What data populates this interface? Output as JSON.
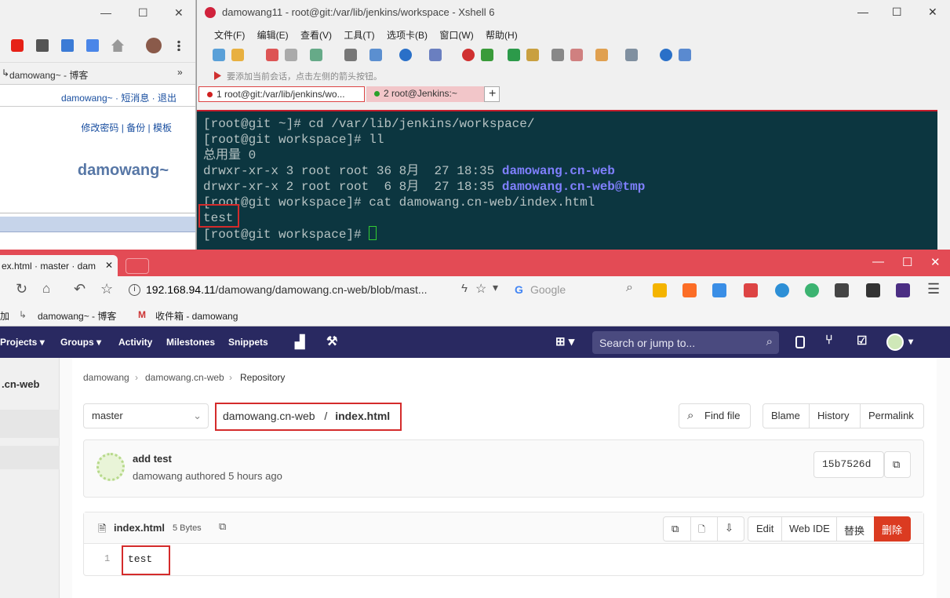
{
  "bg_browser": {
    "bookmark": "damowang~ - 博客",
    "links": "damowang~ · 短消息 · 退出",
    "panel_links": "修改密码 | 备份 | 模板",
    "name": "damowang~"
  },
  "xshell": {
    "title": "damowang11 - root@git:/var/lib/jenkins/workspace - Xshell 6",
    "menu": [
      "文件(F)",
      "编辑(E)",
      "查看(V)",
      "工具(T)",
      "选项卡(B)",
      "窗口(W)",
      "帮助(H)"
    ],
    "hint": "要添加当前会话，点击左侧的箭头按钮。",
    "tabs": [
      "1 root@git:/var/lib/jenkins/wo...",
      "2 root@Jenkins:~"
    ],
    "terminal": {
      "l1": "[root@git ~]# cd /var/lib/jenkins/workspace/",
      "l2": "[root@git workspace]# ll",
      "l3": "总用量 0",
      "l4a": "drwxr-xr-x 3 root root 36 8月  27 18:35 ",
      "l4b": "damowang.cn-web",
      "l5a": "drwxr-xr-x 2 root root  6 8月  27 18:35 ",
      "l5b": "damowang.cn-web@tmp",
      "l6": "[root@git workspace]# cat damowang.cn-web/index.html",
      "l7": "test",
      "l8": "[root@git workspace]# "
    }
  },
  "browser": {
    "tab_title": "ex.html · master · dam",
    "url_host": "192.168.94.11",
    "url_path": "/damowang/damowang.cn-web/blob/mast...",
    "search_placeholder": "Google",
    "bookmarks": [
      "加",
      "damowang~ - 博客",
      "收件箱 - damowang"
    ]
  },
  "gitlab": {
    "nav": [
      "Projects",
      "Groups",
      "Activity",
      "Milestones",
      "Snippets"
    ],
    "search": "Search or jump to...",
    "sidebar_project": ".cn-web",
    "breadcrumb": [
      "damowang",
      "damowang.cn-web",
      "Repository"
    ],
    "branch": "master",
    "path_repo": "damowang.cn-web",
    "path_sep": "/",
    "path_file": "index.html",
    "find_file": "Find file",
    "blame": "Blame",
    "history": "History",
    "permalink": "Permalink",
    "commit_title": "add test",
    "commit_meta": "damowang authored 5 hours ago",
    "commit_sha": "15b7526d",
    "file_name": "index.html",
    "file_size": "5 Bytes",
    "edit": "Edit",
    "web_ide": "Web IDE",
    "replace": "替换",
    "delete": "删除",
    "line_no": "1",
    "line_text": "test"
  }
}
